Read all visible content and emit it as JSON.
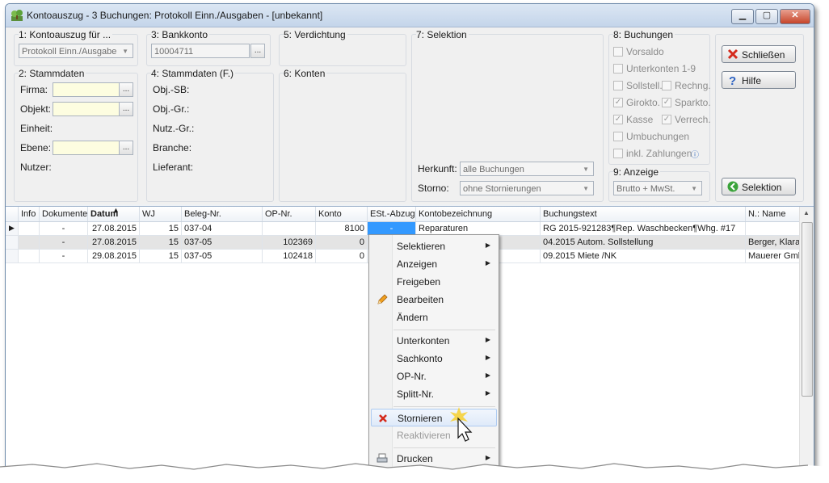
{
  "window": {
    "title": "Kontoauszug - 3 Buchungen:  Protokoll Einn./Ausgaben - [unbekannt]"
  },
  "groups": {
    "kontoauszug": {
      "title": "1: Kontoauszug für ...",
      "value": "Protokoll Einn./Ausgabe"
    },
    "bankkonto": {
      "title": "3: Bankkonto",
      "value": "10004711"
    },
    "verdichtung": {
      "title": "5: Verdichtung"
    },
    "selektion": {
      "title": "7: Selektion",
      "herkunft_label": "Herkunft:",
      "herkunft_value": "alle Buchungen",
      "storno_label": "Storno:",
      "storno_value": "ohne Stornierungen"
    },
    "buchungen": {
      "title": "8: Buchungen",
      "items": [
        {
          "label": "Vorsaldo",
          "checked": false
        },
        {
          "label": "Unterkonten 1-9",
          "checked": false
        },
        {
          "label": "Sollstell.",
          "checked": false
        },
        {
          "label": "Rechng.",
          "checked": false
        },
        {
          "label": "Girokto.",
          "checked": true
        },
        {
          "label": "Sparkto.",
          "checked": true
        },
        {
          "label": "Kasse",
          "checked": true
        },
        {
          "label": "Verrech.",
          "checked": true
        },
        {
          "label": "Umbuchungen",
          "checked": false
        },
        {
          "label": "inkl. Zahlungen",
          "checked": false
        }
      ]
    },
    "stammdaten": {
      "title": "2: Stammdaten",
      "firma": "Firma:",
      "objekt": "Objekt:",
      "einheit": "Einheit:",
      "ebene": "Ebene:",
      "nutzer": "Nutzer:"
    },
    "stammdaten_f": {
      "title": "4: Stammdaten (F.)",
      "objsb": "Obj.-SB:",
      "objgr": "Obj.-Gr.:",
      "nutzgr": "Nutz.-Gr.:",
      "branche": "Branche:",
      "lieferant": "Lieferant:"
    },
    "konten": {
      "title": "6: Konten"
    },
    "anzeige": {
      "title": "9: Anzeige",
      "value": "Brutto + MwSt."
    }
  },
  "buttons": {
    "schliessen": "Schließen",
    "hilfe": "Hilfe",
    "selektion": "Selektion"
  },
  "table": {
    "headers": [
      "Info",
      "Dokumente",
      "Datum",
      "WJ",
      "Beleg-Nr.",
      "OP-Nr.",
      "Konto",
      "ESt.-Abzug",
      "Kontobezeichnung",
      "Buchungstext",
      "N.: Name"
    ],
    "rows": [
      {
        "info": "",
        "dok": "-",
        "datum": "27.08.2015",
        "wj": "15",
        "beleg": "037-04",
        "op": "",
        "konto": "8100",
        "est": "-",
        "kbez": "Reparaturen",
        "text": "RG 2015-921283¶Rep. Waschbecken¶Whg. #17",
        "name": ""
      },
      {
        "info": "",
        "dok": "-",
        "datum": "27.08.2015",
        "wj": "15",
        "beleg": "037-05",
        "op": "102369",
        "konto": "0",
        "est": "",
        "kbez": "",
        "text": "04.2015 Autom. Sollstellung",
        "name": "Berger, Klara"
      },
      {
        "info": "",
        "dok": "-",
        "datum": "29.08.2015",
        "wj": "15",
        "beleg": "037-05",
        "op": "102418",
        "konto": "0",
        "est": "",
        "kbez": "",
        "text": "09.2015 Miete /NK",
        "name": "Mauerer GmbH"
      }
    ]
  },
  "context_menu": {
    "selektieren": "Selektieren",
    "anzeigen": "Anzeigen",
    "freigeben": "Freigeben",
    "bearbeiten": "Bearbeiten",
    "aendern": "Ändern",
    "unterkonten": "Unterkonten",
    "sachkonto": "Sachkonto",
    "opnr": "OP-Nr.",
    "splitt": "Splitt-Nr.",
    "stornieren": "Stornieren",
    "reaktivieren": "Reaktivieren",
    "drucken": "Drucken"
  }
}
